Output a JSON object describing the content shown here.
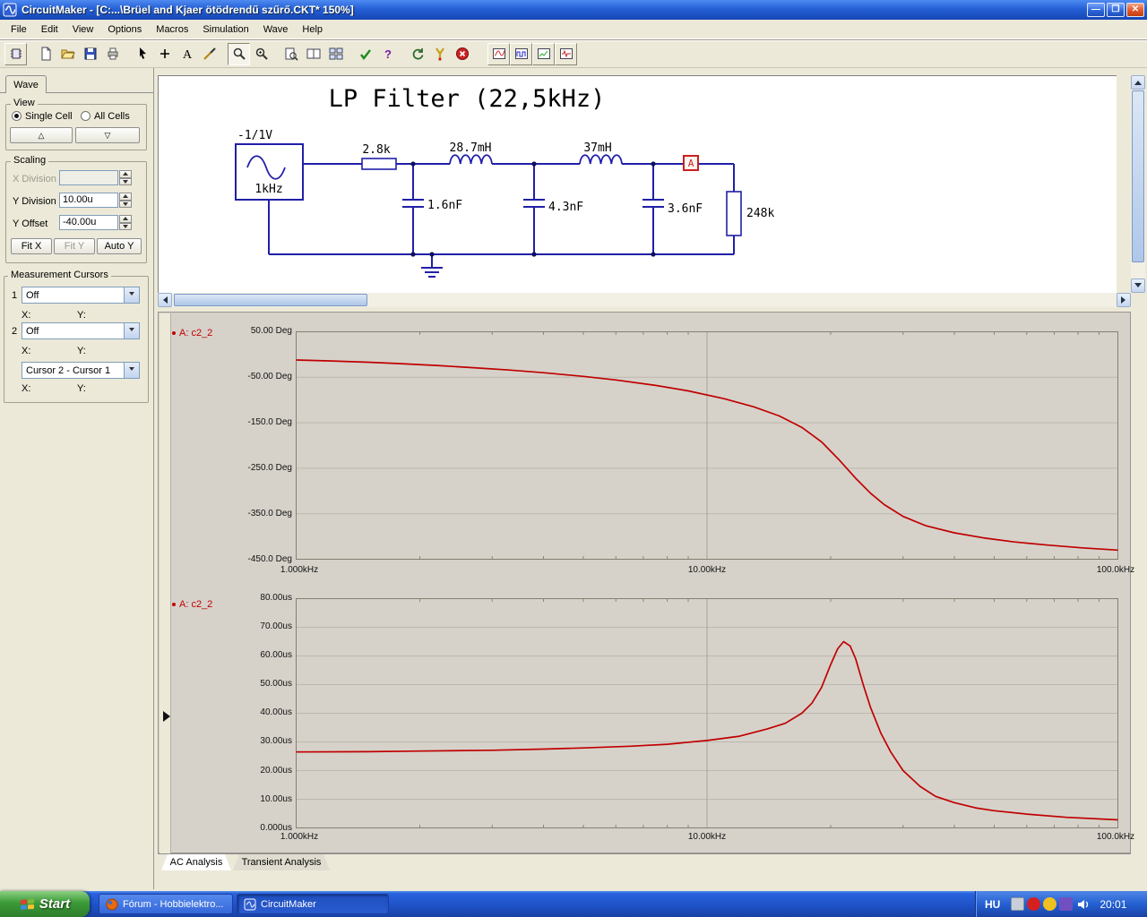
{
  "window": {
    "title": "CircuitMaker - [C:...\\Brüel and Kjaer ötödrendű szűrő.CKT* 150%]"
  },
  "menu": {
    "items": [
      "File",
      "Edit",
      "View",
      "Options",
      "Macros",
      "Simulation",
      "Wave",
      "Help"
    ]
  },
  "toolbar": {
    "text_tool_label": "A",
    "help_label": "?",
    "icons": [
      "parts-browser",
      "new-document",
      "open-file",
      "save",
      "print",
      "pointer",
      "add-part",
      "text-tool",
      "wire-tool",
      "zoom-select",
      "zoom-in",
      "page-zoom",
      "split-window",
      "tile-windows",
      "rules-check",
      "help",
      "reset-simulation",
      "probe",
      "stop-simulation",
      "analog-waveform",
      "digital-waveform",
      "signal-trace",
      "pulse-trace"
    ]
  },
  "wave_panel": {
    "tab_label": "Wave",
    "view_group": {
      "legend": "View",
      "radio1": "Single Cell",
      "radio2": "All Cells",
      "up_glyph": "△",
      "down_glyph": "▽"
    },
    "scaling_group": {
      "legend": "Scaling",
      "x_division_label": "X Division",
      "x_division_value": "",
      "y_division_label": "Y Division",
      "y_division_value": "10.00u",
      "y_offset_label": "Y Offset",
      "y_offset_value": "-40.00u",
      "fit_x": "Fit X",
      "fit_y": "Fit Y",
      "auto_y": "Auto Y"
    },
    "cursors_group": {
      "legend": "Measurement Cursors",
      "row1_num": "1",
      "row1_value": "Off",
      "row2_num": "2",
      "row2_value": "Off",
      "x_label": "X:",
      "y_label": "Y:",
      "diff_value": "Cursor 2 - Cursor 1"
    }
  },
  "circuit": {
    "title": "LP Filter (22,5kHz)",
    "source_voltage": "-1/1V",
    "source_freq": "1kHz",
    "r1": "2.8k",
    "l1": "28.7mH",
    "l2": "37mH",
    "c1": "1.6nF",
    "c2": "4.3nF",
    "c3": "3.6nF",
    "r2": "248k",
    "probe": "A"
  },
  "tabs": {
    "ac": "AC Analysis",
    "transient": "Transient Analysis"
  },
  "taskbar": {
    "start_label": "Start",
    "task1_label": "Fórum - Hobbielektro...",
    "task2_label": "CircuitMaker",
    "language": "HU",
    "clock": "20:01"
  },
  "chart_data": [
    {
      "type": "line",
      "title": "AC Analysis - Phase response",
      "series_label": "A: c2_2",
      "x_scale": "log",
      "x_range_hz": [
        1000,
        100000
      ],
      "x_tick_labels": [
        "1.000kHz",
        "10.00kHz",
        "100.0kHz"
      ],
      "y_tick_labels": [
        "50.00 Deg",
        "-50.00 Deg",
        "-150.0 Deg",
        "-250.0 Deg",
        "-350.0 Deg",
        "-450.0 Deg"
      ],
      "ylim": [
        -450,
        50
      ],
      "grid": true,
      "color": "#C00000",
      "points": [
        [
          1000,
          -12
        ],
        [
          1200,
          -14
        ],
        [
          1500,
          -17
        ],
        [
          1800,
          -20
        ],
        [
          2200,
          -24
        ],
        [
          2700,
          -29
        ],
        [
          3300,
          -34
        ],
        [
          4000,
          -40
        ],
        [
          5000,
          -48
        ],
        [
          6000,
          -56
        ],
        [
          7500,
          -68
        ],
        [
          9000,
          -80
        ],
        [
          11000,
          -97
        ],
        [
          13000,
          -115
        ],
        [
          15000,
          -135
        ],
        [
          17000,
          -160
        ],
        [
          19000,
          -192
        ],
        [
          21000,
          -232
        ],
        [
          23000,
          -272
        ],
        [
          25000,
          -305
        ],
        [
          27000,
          -330
        ],
        [
          30000,
          -356
        ],
        [
          34000,
          -376
        ],
        [
          40000,
          -392
        ],
        [
          47000,
          -403
        ],
        [
          56000,
          -412
        ],
        [
          68000,
          -419
        ],
        [
          82000,
          -425
        ],
        [
          100000,
          -430
        ]
      ]
    },
    {
      "type": "line",
      "title": "AC Analysis - Group delay",
      "series_label": "A: c2_2",
      "x_scale": "log",
      "x_range_hz": [
        1000,
        100000
      ],
      "x_tick_labels": [
        "1.000kHz",
        "10.00kHz",
        "100.0kHz"
      ],
      "y_tick_labels": [
        "80.00us",
        "70.00us",
        "60.00us",
        "50.00us",
        "40.00us",
        "30.00us",
        "20.00us",
        "10.00us",
        "0.000us"
      ],
      "ylim": [
        0,
        80
      ],
      "grid": true,
      "color": "#C00000",
      "points": [
        [
          1000,
          26.5
        ],
        [
          1500,
          26.6
        ],
        [
          2000,
          26.8
        ],
        [
          3000,
          27.1
        ],
        [
          4000,
          27.5
        ],
        [
          5000,
          27.9
        ],
        [
          6500,
          28.5
        ],
        [
          8000,
          29.2
        ],
        [
          10000,
          30.5
        ],
        [
          12000,
          32.0
        ],
        [
          14000,
          34.5
        ],
        [
          15500,
          36.5
        ],
        [
          17000,
          40.0
        ],
        [
          18000,
          43.5
        ],
        [
          19000,
          49.0
        ],
        [
          20000,
          57.0
        ],
        [
          20800,
          62.5
        ],
        [
          21500,
          65.0
        ],
        [
          22300,
          63.5
        ],
        [
          23000,
          59.0
        ],
        [
          24000,
          50.0
        ],
        [
          25000,
          42.0
        ],
        [
          26500,
          33.0
        ],
        [
          28000,
          26.5
        ],
        [
          30000,
          20.0
        ],
        [
          33000,
          14.5
        ],
        [
          36000,
          11.0
        ],
        [
          40000,
          8.8
        ],
        [
          45000,
          7.0
        ],
        [
          50000,
          6.0
        ],
        [
          60000,
          4.8
        ],
        [
          75000,
          3.7
        ],
        [
          100000,
          2.8
        ]
      ]
    }
  ]
}
